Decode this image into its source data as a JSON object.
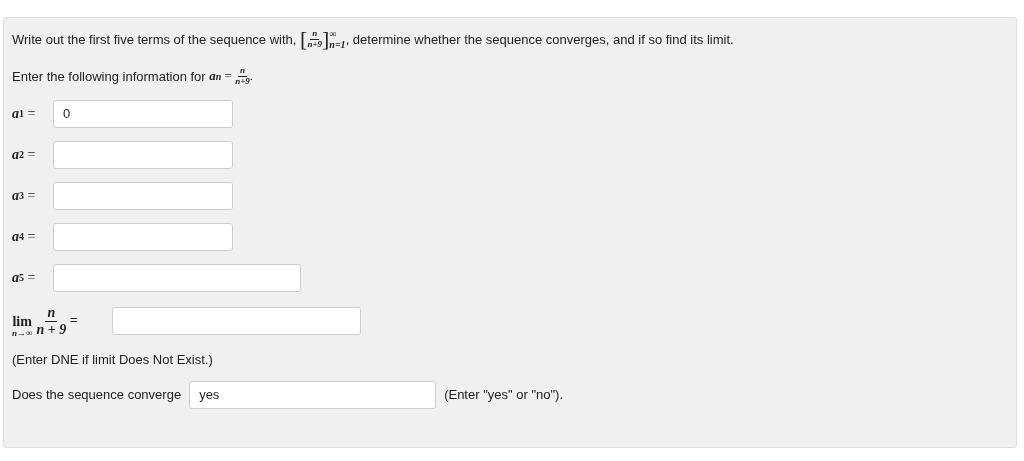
{
  "intro": {
    "before": "Write out the first five terms of the sequence with,",
    "seq": {
      "open": "[",
      "close": "]",
      "num": "n",
      "den": "n+9",
      "sup": "∞",
      "sub": "n=1"
    },
    "after": ", determine whether the sequence converges, and if so find its limit."
  },
  "formula": {
    "text": "Enter the following information for",
    "lhs": "a",
    "lhs_sub": "n",
    "eq": "=",
    "num": "n",
    "den": "n+9",
    "end": "."
  },
  "terms": [
    {
      "symbol": "a",
      "index": "1",
      "eq": "=",
      "value": "0"
    },
    {
      "symbol": "a",
      "index": "2",
      "eq": "="
    },
    {
      "symbol": "a",
      "index": "3",
      "eq": "="
    },
    {
      "symbol": "a",
      "index": "4",
      "eq": "="
    },
    {
      "symbol": "a",
      "index": "5",
      "eq": "="
    }
  ],
  "limit": {
    "lim": "lim",
    "under": "n→∞",
    "num": "n",
    "den": "n + 9",
    "eq": "="
  },
  "note": "(Enter DNE if limit Does Not Exist.)",
  "converge": {
    "label": "Does the sequence converge",
    "value": "yes",
    "hint": "(Enter \"yes\" or \"no\")."
  }
}
